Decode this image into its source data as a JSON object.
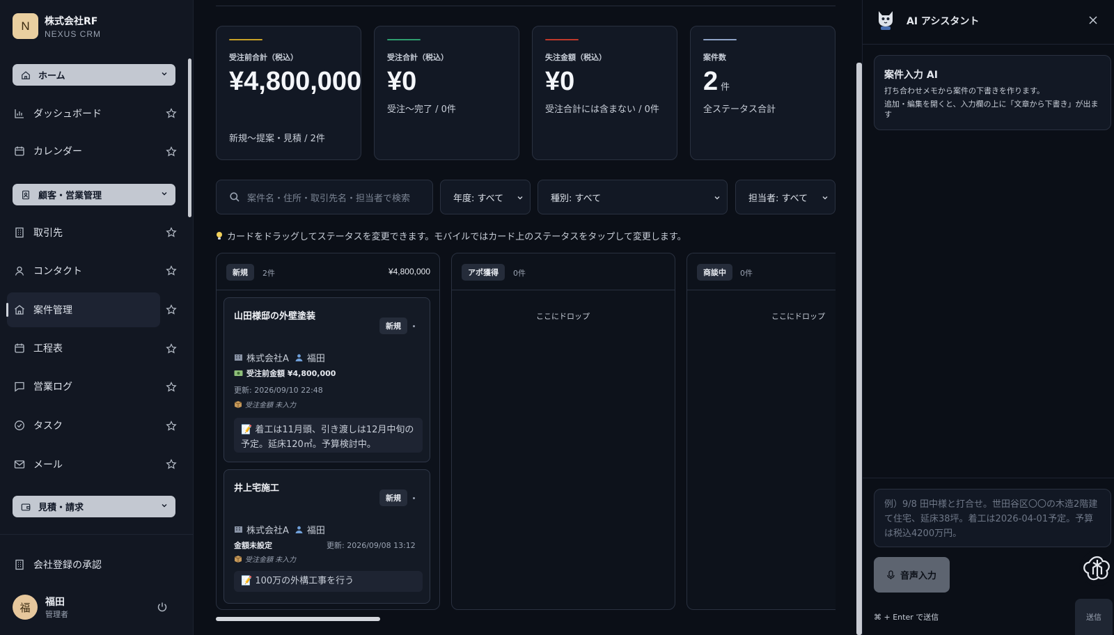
{
  "brand": {
    "initial": "N",
    "company": "株式会社RF",
    "product": "NEXUS CRM"
  },
  "sidebar": {
    "sections": [
      {
        "label": "ホーム"
      },
      {
        "label": "顧客・営業管理"
      },
      {
        "label": "見積・請求"
      }
    ],
    "items": [
      {
        "label": "ダッシュボード",
        "icon": "chart-icon"
      },
      {
        "label": "カレンダー",
        "icon": "calendar-icon"
      },
      {
        "label": "取引先",
        "icon": "building-icon"
      },
      {
        "label": "コンタクト",
        "icon": "person-icon"
      },
      {
        "label": "案件管理",
        "icon": "home-icon",
        "active": true
      },
      {
        "label": "工程表",
        "icon": "calendar-icon"
      },
      {
        "label": "営業ログ",
        "icon": "message-icon"
      },
      {
        "label": "タスク",
        "icon": "check-circle-icon"
      },
      {
        "label": "メール",
        "icon": "mail-icon"
      }
    ],
    "footer_link": "会社登録の承認",
    "user": {
      "avatar": "福",
      "name": "福田",
      "role": "管理者"
    }
  },
  "kpis": [
    {
      "label": "受注前合計（税込）",
      "value": "¥4,800,000",
      "sub": "新規〜提案・見積 / 2件",
      "accent": "#c9a227"
    },
    {
      "label": "受注合計（税込）",
      "value": "¥0",
      "sub": "受注〜完了 / 0件",
      "accent": "#2f9e6f"
    },
    {
      "label": "失注金額（税込）",
      "value": "¥0",
      "sub": "受注合計には含まない / 0件",
      "accent": "#c0392b"
    },
    {
      "label": "案件数",
      "value": "2",
      "unit": "件",
      "sub": "全ステータス合計",
      "accent": "#8fa3c7"
    }
  ],
  "filters": {
    "search_placeholder": "案件名・住所・取引先名・担当者で検索",
    "year": "年度: すべて",
    "type": "種別: すべて",
    "owner": "担当者: すべて"
  },
  "hint": "カードをドラッグしてステータスを変更できます。モバイルではカード上のステータスをタップして変更します。",
  "kanban": {
    "columns": [
      {
        "tag": "新規",
        "count": "2件",
        "total": "¥4,800,000"
      },
      {
        "tag": "アポ獲得",
        "count": "0件",
        "drop": "ここにドロップ"
      },
      {
        "tag": "商談中",
        "count": "0件",
        "drop": "ここにドロップ"
      }
    ],
    "cards": [
      {
        "title": "山田様邸の外壁塗装",
        "status": "新規",
        "company": "株式会社A",
        "owner": "福田",
        "amount": "受注前金額 ¥4,800,000",
        "updated": "更新: 2026/09/10 22:48",
        "unset": "受注金額 未入力",
        "memo": "着工は11月頭、引き渡しは12月中旬の予定。延床120㎡。予算検討中。"
      },
      {
        "title": "井上宅施工",
        "status": "新規",
        "company": "株式会社A",
        "owner": "福田",
        "amount": "金額未設定",
        "updated": "更新: 2026/09/08 13:12",
        "unset": "受注金額 未入力",
        "memo": "100万の外構工事を行う"
      }
    ]
  },
  "ai": {
    "title": "AI アシスタント",
    "card_title": "案件入力 AI",
    "card_line1": "打ち合わせメモから案件の下書きを作ります。",
    "card_line2": "追加・編集を開くと、入力欄の上に「文章から下書き」が出ます",
    "input_placeholder": "例）9/8 田中様と打合せ。世田谷区〇〇の木造2階建て住宅、延床38坪。着工は2026-04-01予定。予算は税込4200万円。",
    "voice_label": "音声入力",
    "send_hint": "⌘ + Enter で送信",
    "send_label": "送信"
  }
}
